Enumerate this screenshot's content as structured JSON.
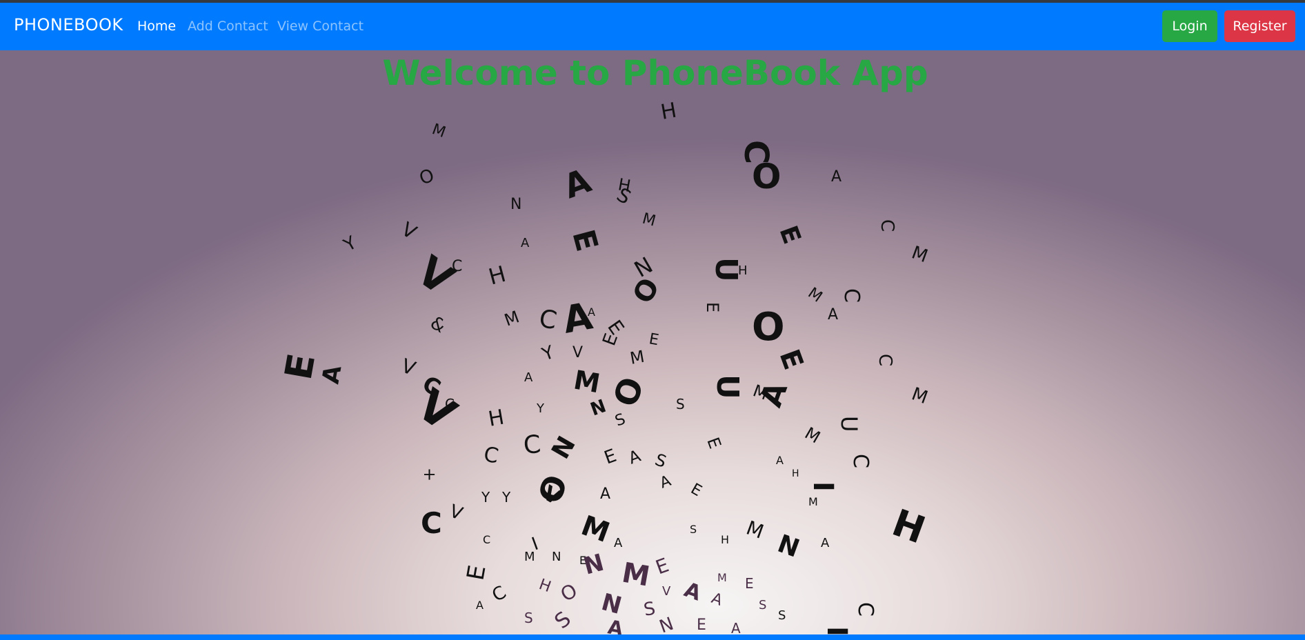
{
  "navbar": {
    "brand": "PHONEBOOK",
    "links": [
      {
        "label": "Home",
        "active": true
      },
      {
        "label": "Add Contact",
        "active": false
      },
      {
        "label": "View Contact",
        "active": false
      }
    ],
    "login_label": "Login",
    "register_label": "Register"
  },
  "hero": {
    "title": "Welcome to PhoneBook App"
  },
  "colors": {
    "navbar": "#007bff",
    "title": "#28a745",
    "login": "#28a745",
    "register": "#dc3545"
  }
}
